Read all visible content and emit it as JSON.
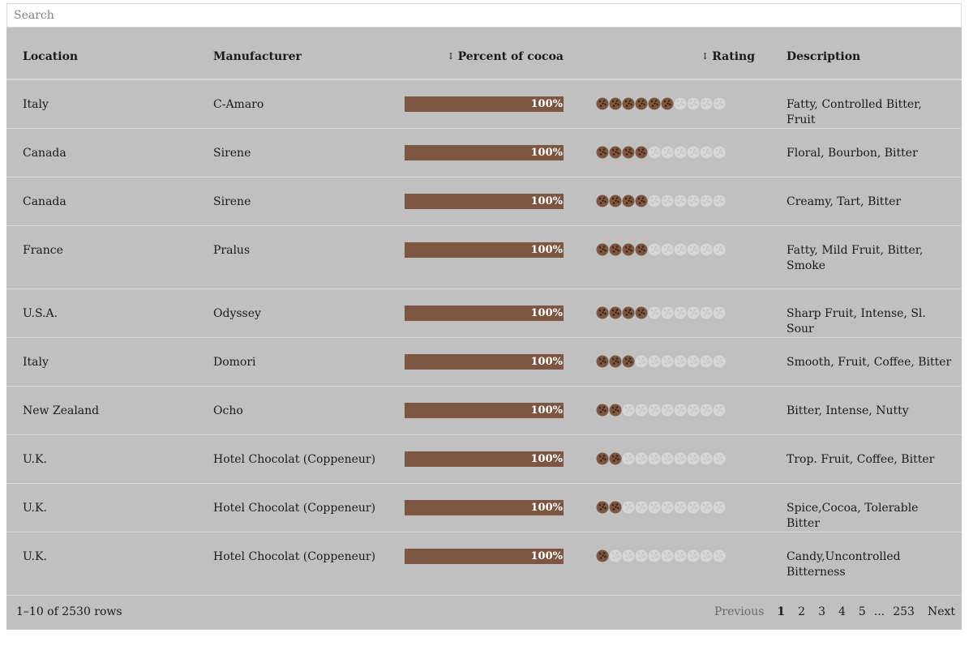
{
  "search": {
    "placeholder": "Search",
    "value": ""
  },
  "columns": {
    "location": "Location",
    "manufacturer": "Manufacturer",
    "percent": "Percent of cocoa",
    "rating": "Rating",
    "description": "Description"
  },
  "rating_max": 10,
  "colors": {
    "bar": "#7c5641",
    "cookie_filled": "#7c5641",
    "cookie_empty": "#d6d6d6",
    "table_bg": "#bfc0bf"
  },
  "rows": [
    {
      "location": "Italy",
      "manufacturer": "C-Amaro",
      "percent": "100%",
      "percent_value": 100,
      "rating": 6,
      "description": "Fatty, Controlled Bitter, Fruit"
    },
    {
      "location": "Canada",
      "manufacturer": "Sirene",
      "percent": "100%",
      "percent_value": 100,
      "rating": 4,
      "description": "Floral, Bourbon, Bitter"
    },
    {
      "location": "Canada",
      "manufacturer": "Sirene",
      "percent": "100%",
      "percent_value": 100,
      "rating": 4,
      "description": "Creamy, Tart, Bitter"
    },
    {
      "location": "France",
      "manufacturer": "Pralus",
      "percent": "100%",
      "percent_value": 100,
      "rating": 4,
      "description": "Fatty, Mild Fruit, Bitter, Smoke"
    },
    {
      "location": "U.S.A.",
      "manufacturer": "Odyssey",
      "percent": "100%",
      "percent_value": 100,
      "rating": 4,
      "description": "Sharp Fruit, Intense, Sl. Sour"
    },
    {
      "location": "Italy",
      "manufacturer": "Domori",
      "percent": "100%",
      "percent_value": 100,
      "rating": 3,
      "description": "Smooth, Fruit, Coffee, Bitter"
    },
    {
      "location": "New Zealand",
      "manufacturer": "Ocho",
      "percent": "100%",
      "percent_value": 100,
      "rating": 2,
      "description": "Bitter, Intense, Nutty"
    },
    {
      "location": "U.K.",
      "manufacturer": "Hotel Chocolat (Coppeneur)",
      "percent": "100%",
      "percent_value": 100,
      "rating": 2,
      "description": "Trop. Fruit, Coffee, Bitter"
    },
    {
      "location": "U.K.",
      "manufacturer": "Hotel Chocolat (Coppeneur)",
      "percent": "100%",
      "percent_value": 100,
      "rating": 2,
      "description": "Spice,Cocoa, Tolerable Bitter"
    },
    {
      "location": "U.K.",
      "manufacturer": "Hotel Chocolat (Coppeneur)",
      "percent": "100%",
      "percent_value": 100,
      "rating": 1,
      "description": "Candy,Uncontrolled Bitterness"
    }
  ],
  "footer": {
    "count": "1–10 of 2530 rows",
    "previous": "Previous",
    "pages": [
      "1",
      "2",
      "3",
      "4",
      "5"
    ],
    "ellipsis": "...",
    "last_page": "253",
    "next": "Next",
    "current_page": "1"
  }
}
